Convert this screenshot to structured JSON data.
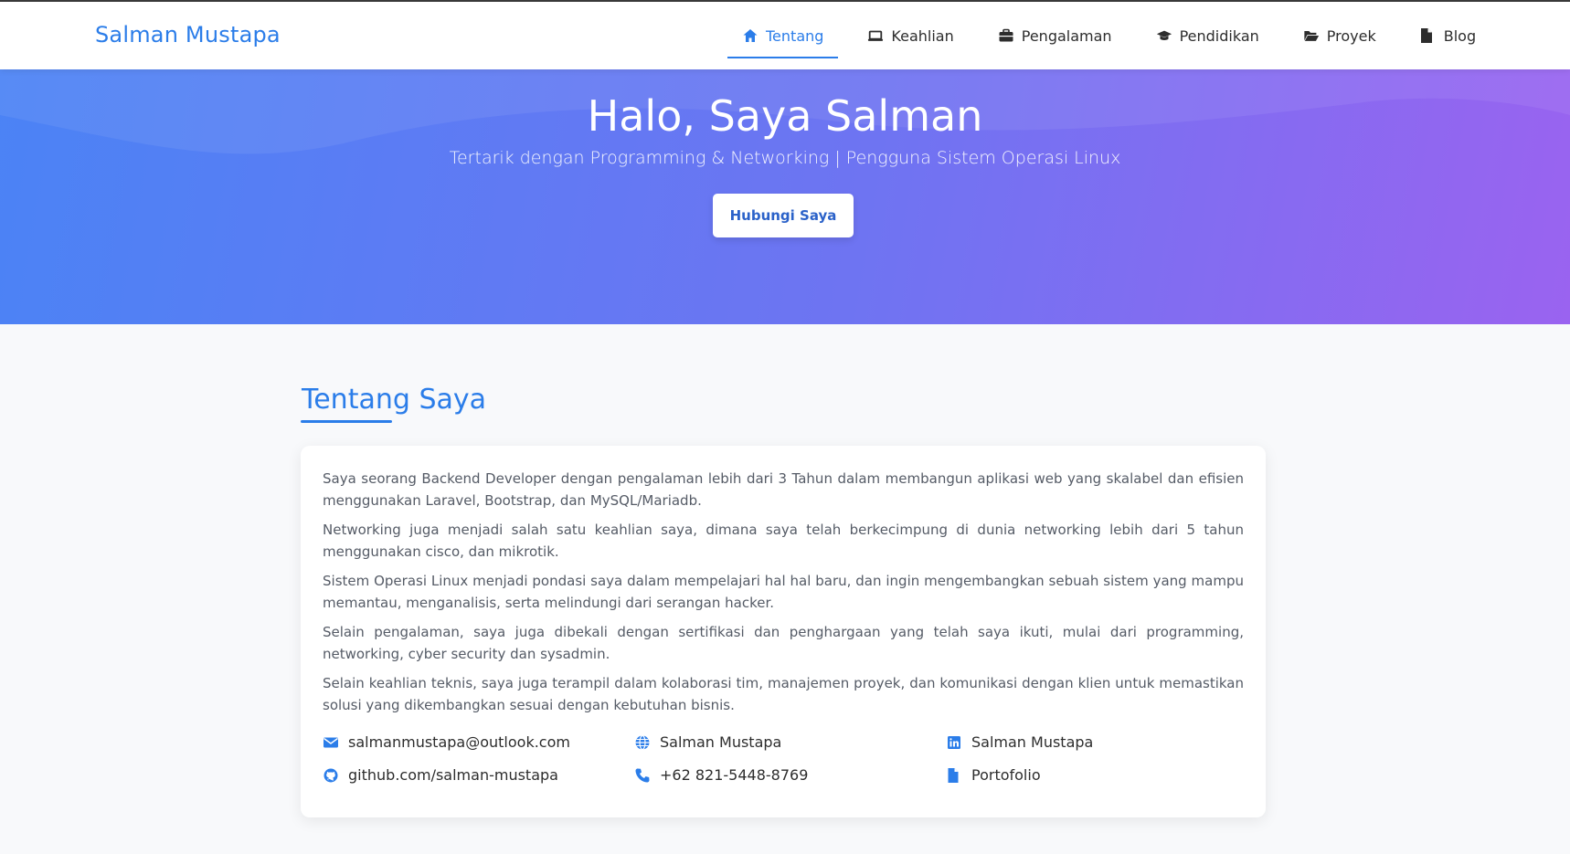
{
  "navbar": {
    "brand": "Salman Mustapa",
    "items": [
      {
        "label": "Tentang",
        "icon": "home-icon"
      },
      {
        "label": "Keahlian",
        "icon": "laptop-icon"
      },
      {
        "label": "Pengalaman",
        "icon": "briefcase-icon"
      },
      {
        "label": "Pendidikan",
        "icon": "graduation-cap-icon"
      },
      {
        "label": "Proyek",
        "icon": "folder-open-icon"
      },
      {
        "label": "Blog",
        "icon": "file-icon"
      }
    ],
    "active_index": 0
  },
  "hero": {
    "title": "Halo, Saya Salman",
    "subtitle": "Tertarik dengan Programming & Networking | Pengguna Sistem Operasi Linux",
    "button_label": "Hubungi Saya"
  },
  "about": {
    "title": "Tentang Saya",
    "paragraphs": [
      "Saya seorang Backend Developer dengan pengalaman lebih dari 3 Tahun dalam membangun aplikasi web yang skalabel dan efisien menggunakan Laravel, Bootstrap, dan MySQL/Mariadb.",
      "Networking juga menjadi salah satu keahlian saya, dimana saya telah berkecimpung di dunia networking lebih dari 5 tahun menggunakan cisco, dan mikrotik.",
      "Sistem Operasi Linux menjadi pondasi saya dalam mempelajari hal hal baru, dan ingin mengembangkan sebuah sistem yang mampu memantau, menganalisis, serta melindungi dari serangan hacker.",
      "Selain pengalaman, saya juga dibekali dengan sertifikasi dan penghargaan yang telah saya ikuti, mulai dari programming, networking, cyber security dan sysadmin.",
      "Selain keahlian teknis, saya juga terampil dalam kolaborasi tim, manajemen proyek, dan komunikasi dengan klien untuk memastikan solusi yang dikembangkan sesuai dengan kebutuhan bisnis."
    ],
    "contacts": {
      "email": "salmanmustapa@outlook.com",
      "website": "Salman Mustapa",
      "linkedin": "Salman Mustapa",
      "github": "github.com/salman-mustapa",
      "phone": "+62 821-5448-8769",
      "portfolio": "Portofolio"
    }
  },
  "colors": {
    "accent": "#2b7de9",
    "hero_gradient_start": "#4b83f5",
    "hero_gradient_end": "#9a63f0"
  }
}
